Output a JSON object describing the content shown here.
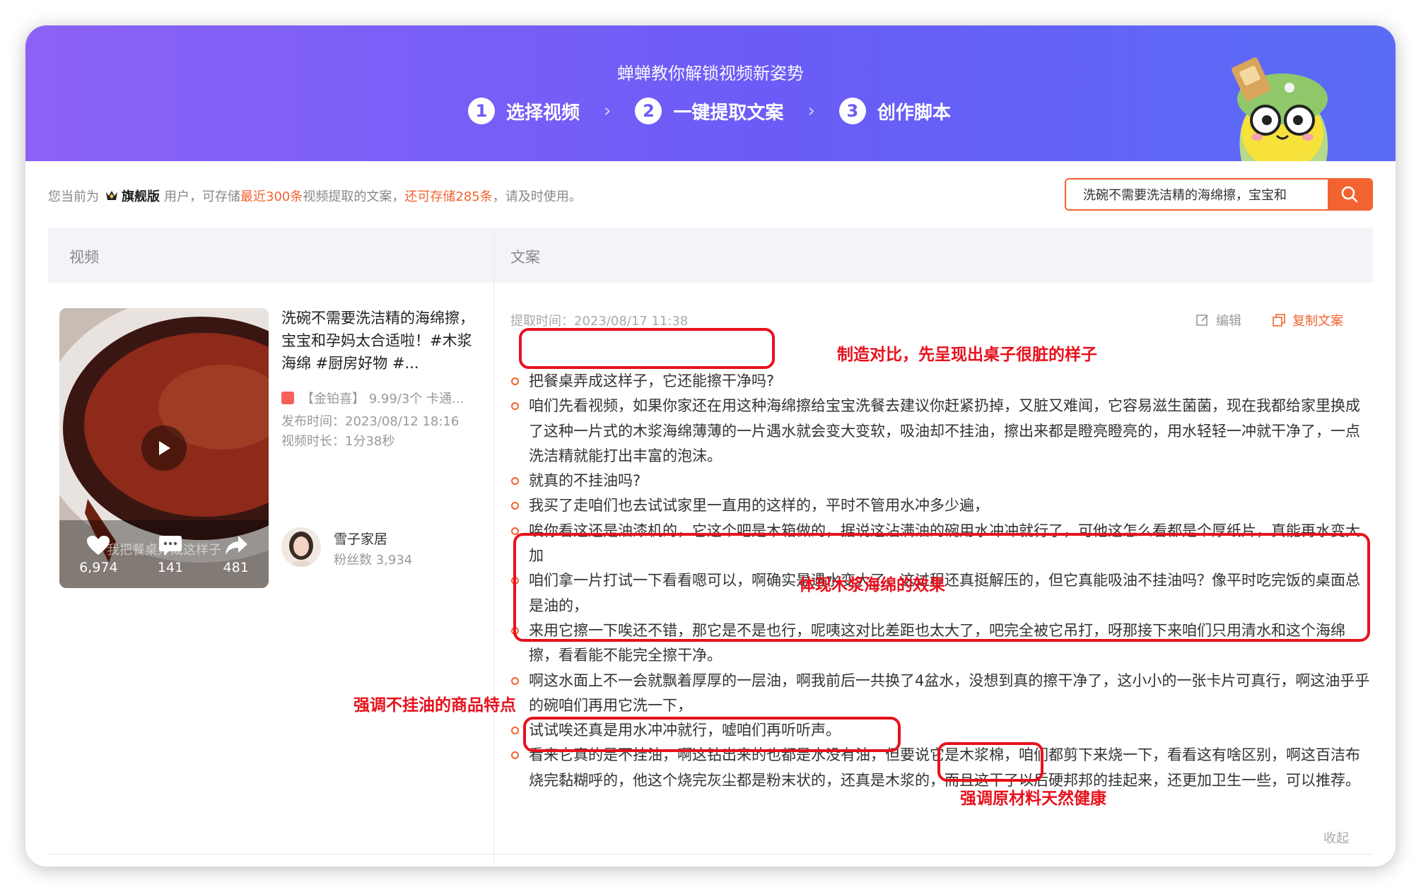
{
  "banner": {
    "title": "蝉蝉教你解锁视频新姿势",
    "steps": [
      {
        "num": "1",
        "label": "选择视频"
      },
      {
        "num": "2",
        "label": "一键提取文案"
      },
      {
        "num": "3",
        "label": "创作脚本"
      }
    ],
    "step_separator": "›"
  },
  "info": {
    "prefix": "您当前为",
    "plan": "旗舰版",
    "mid": "用户，可存储",
    "limit": "最近300条",
    "mid2": "视频提取的文案，",
    "remaining": "还可存储285条",
    "suffix": "，请及时使用。"
  },
  "search": {
    "value": "洗碗不需要洗洁精的海绵擦，宝宝和"
  },
  "table": {
    "col_video": "视频",
    "col_copy": "文案"
  },
  "video": {
    "title": "洗碗不需要洗洁精的海绵擦，宝宝和孕妈太合适啦！#木浆海绵 #厨房好物 #...",
    "product_tag": "【金铂喜】 9.99/3个 卡通...",
    "publish_time": "发布时间：2023/08/12 18:16",
    "duration": "视频时长：1分38秒",
    "caption": "我把餐桌弄成这样子",
    "stats": {
      "likes": "6,974",
      "comments": "141",
      "shares": "481"
    },
    "author_name": "雪子家居",
    "author_fans": "粉丝数 3,934"
  },
  "copy": {
    "extract_time": "提取时间：2023/08/17 11:38",
    "edit_label": "编辑",
    "copy_label": "复制文案",
    "collapse_label": "收起",
    "lines": [
      "把餐桌弄成这样子，它还能擦干净吗?",
      "咱们先看视频，如果你家还在用这种海绵擦给宝宝洗餐去建议你赶紧扔掉，又脏又难闻，它容易滋生菌菌，现在我都给家里换成了这种一片式的木浆海绵薄薄的一片遇水就会变大变软，吸油却不挂油，擦出来都是瞪亮瞪亮的，用水轻轻一冲就干净了，一点洗洁精就能打出丰富的泡沫。",
      "就真的不挂油吗?",
      "我买了走咱们也去试试家里一直用的这样的，平时不管用水冲多少遍，",
      "唉你看这还是油漆机的，它这个吧是木箱做的，据说这沾满油的碗用水冲冲就行了，可他这怎么看都是个厚纸片，真能再水变大加",
      "咱们拿一片打试一下看看嗯可以，啊确实是遇水变大了，这过程还真挺解压的，但它真能吸油不挂油吗？像平时吃完饭的桌面总是油的，",
      "来用它擦一下唉还不错，那它是不是也行，呢咦这对比差距也太大了，吧完全被它吊打，呀那接下来咱们只用清水和这个海绵擦，看看能不能完全擦干净。",
      "啊这水面上不一会就飘着厚厚的一层油，啊我前后一共换了4盆水，没想到真的擦干净了，这小小的一张卡片可真行，啊这油乎乎的碗咱们再用它洗一下，",
      "试试唉还真是用水冲冲就行，嘘咱们再听听声。",
      "看来它真的是不挂油，啊这钻出来的也都是水没有油，但要说它是木浆棉，咱们都剪下来烧一下，看看这有啥区别，啊这百洁布烧完黏糊呼的，他这个烧完灰尘都是粉末状的，还真是木浆的，而且这干了以后硬邦邦的挂起来，还更加卫生一些，可以推荐。"
    ]
  },
  "annotations": [
    "制造对比，先呈现出桌子很脏的样子",
    "体现木浆海绵的效果",
    "强调不挂油的商品特点",
    "强调原材料天然健康"
  ],
  "colors": {
    "accent": "#f2632f",
    "banner_start": "#8b62f5",
    "banner_end": "#5a6cf6",
    "annotation": "#e8111d"
  }
}
